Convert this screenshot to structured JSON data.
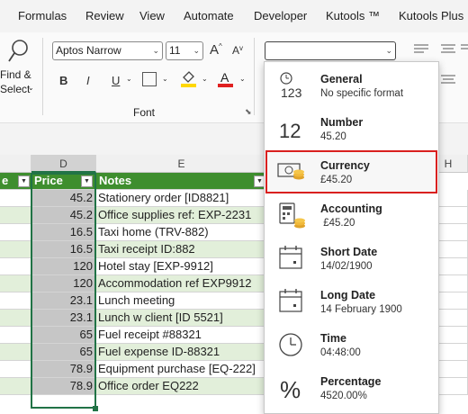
{
  "menu": [
    "Formulas",
    "Review",
    "View",
    "Automate",
    "Developer",
    "Kutools ™",
    "Kutools Plus"
  ],
  "ribbon": {
    "find_select_line1": "Find &",
    "find_select_line2": "Select",
    "font_name": "Aptos Narrow",
    "font_size": "11",
    "grow_font": "A",
    "shrink_font": "A",
    "bold": "B",
    "italic": "I",
    "underline": "U",
    "font_color_letter": "A",
    "font_group_label": "Font",
    "number_format_value": "",
    "colors": {
      "fill_highlight": "#ffd700",
      "font_color": "#e02020"
    }
  },
  "grid": {
    "columns": {
      "c": "",
      "d": "D",
      "e": "E",
      "h": "H"
    },
    "headers": {
      "c": "e",
      "price": "Price",
      "notes": "Notes"
    },
    "rows": [
      {
        "price": "45.2",
        "note": "Stationery order [ID8821]"
      },
      {
        "price": "45.2",
        "note": "Office supplies ref: EXP-2231"
      },
      {
        "price": "16.5",
        "note": "Taxi home (TRV-882)"
      },
      {
        "price": "16.5",
        "note": "Taxi receipt ID:882"
      },
      {
        "price": "120",
        "note": "Hotel stay [EXP-9912]"
      },
      {
        "price": "120",
        "note": "Accommodation ref EXP9912"
      },
      {
        "price": "23.1",
        "note": "Lunch meeting"
      },
      {
        "price": "23.1",
        "note": "Lunch w client [ID 5521]"
      },
      {
        "price": "65",
        "note": "Fuel receipt #88321"
      },
      {
        "price": "65",
        "note": "Fuel expense ID-88321"
      },
      {
        "price": "78.9",
        "note": "Equipment purchase [EQ-222]"
      },
      {
        "price": "78.9",
        "note": "Office order EQ222"
      }
    ],
    "colors": {
      "header_green": "#3e8e2e",
      "note_row_green": "#e2efda",
      "selection": "#c6c6c6"
    }
  },
  "number_formats": [
    {
      "title": "General",
      "subtitle": "No specific format",
      "icon": "general-icon"
    },
    {
      "title": "Number",
      "subtitle": "45.20",
      "icon": "number-icon"
    },
    {
      "title": "Currency",
      "subtitle": "£45.20",
      "icon": "currency-icon"
    },
    {
      "title": "Accounting",
      "subtitle": " £45.20",
      "icon": "accounting-icon"
    },
    {
      "title": "Short Date",
      "subtitle": "14/02/1900",
      "icon": "calendar-icon"
    },
    {
      "title": "Long Date",
      "subtitle": "14 February 1900",
      "icon": "calendar-icon"
    },
    {
      "title": "Time",
      "subtitle": "04:48:00",
      "icon": "clock-icon"
    },
    {
      "title": "Percentage",
      "subtitle": "4520.00%",
      "icon": "percent-icon"
    }
  ],
  "icon_text": {
    "general": "123",
    "number": "12",
    "percent": "%"
  }
}
